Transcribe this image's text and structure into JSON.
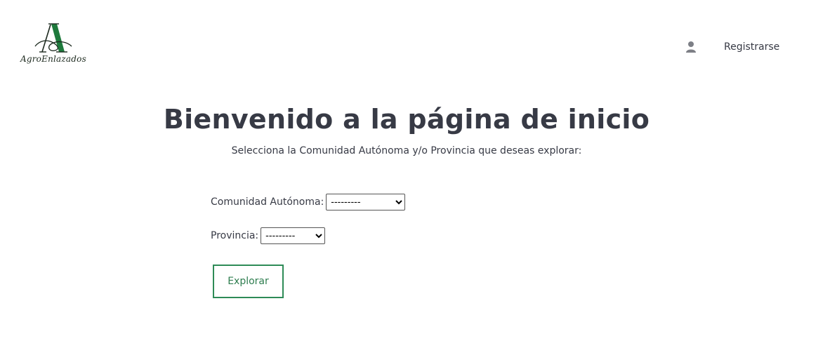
{
  "header": {
    "logo_text": "AgroEnlazados",
    "register_link": "Registrarse",
    "user_icon": "user-icon"
  },
  "main": {
    "title": "Bienvenido a la página de inicio",
    "subtitle": "Selecciona la Comunidad Autónoma y/o Provincia que deseas explorar:",
    "comunidad_label": "Comunidad Autónoma:",
    "comunidad_selected": "---------",
    "provincia_label": "Provincia:",
    "provincia_selected": "---------",
    "explore_button": "Explorar"
  },
  "colors": {
    "accent": "#2e8b57",
    "text": "#373a45",
    "logo_green": "#1e7a3c"
  }
}
